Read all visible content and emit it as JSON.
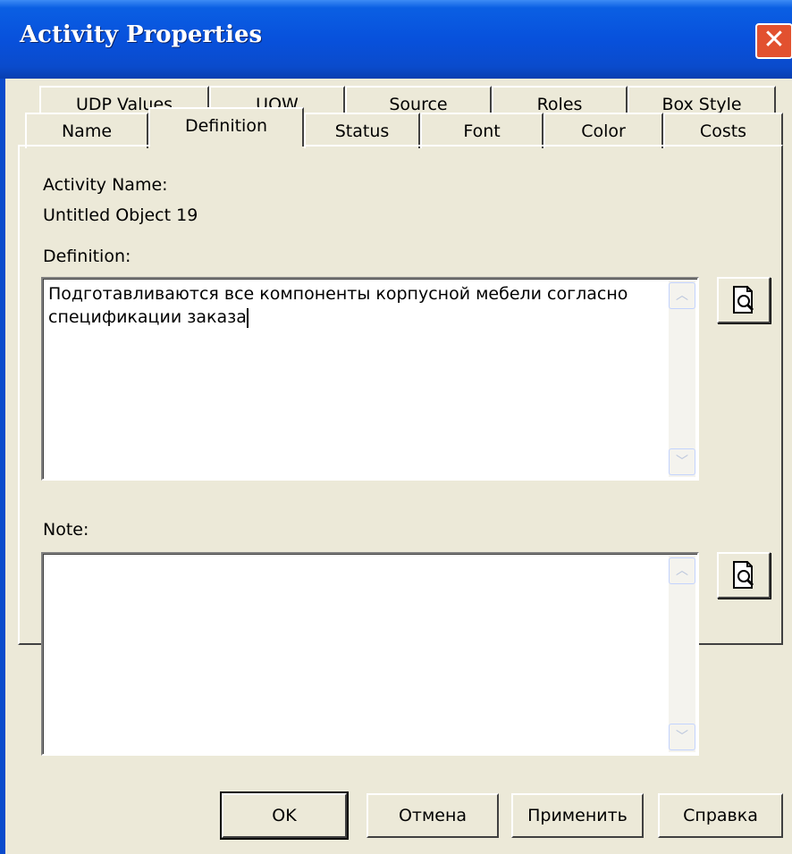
{
  "window": {
    "title": "Activity Properties",
    "close_symbol": "✕"
  },
  "tabs": {
    "row1": [
      "UDP Values",
      "UOW",
      "Source",
      "Roles",
      "Box Style"
    ],
    "row2": [
      "Name",
      "Definition",
      "Status",
      "Font",
      "Color",
      "Costs"
    ],
    "selected": "Definition"
  },
  "definition_page": {
    "activity_name_label": "Activity Name:",
    "activity_name_value": "Untitled Object 19",
    "definition_label": "Definition:",
    "definition_text": "Подготавливаются все компоненты корпусной мебели согласно спецификации заказа",
    "note_label": "Note:",
    "note_text": ""
  },
  "buttons": {
    "ok": "OK",
    "cancel": "Отмена",
    "apply": "Применить",
    "help": "Справка"
  },
  "icons": {
    "browse": "zoom-document-icon",
    "scroll_up": "chevron-up-icon",
    "scroll_down": "chevron-down-icon"
  },
  "colors": {
    "titlebar": "#0a4bcc",
    "close_button": "#e2512f",
    "dialog_face": "#ece9d8"
  }
}
